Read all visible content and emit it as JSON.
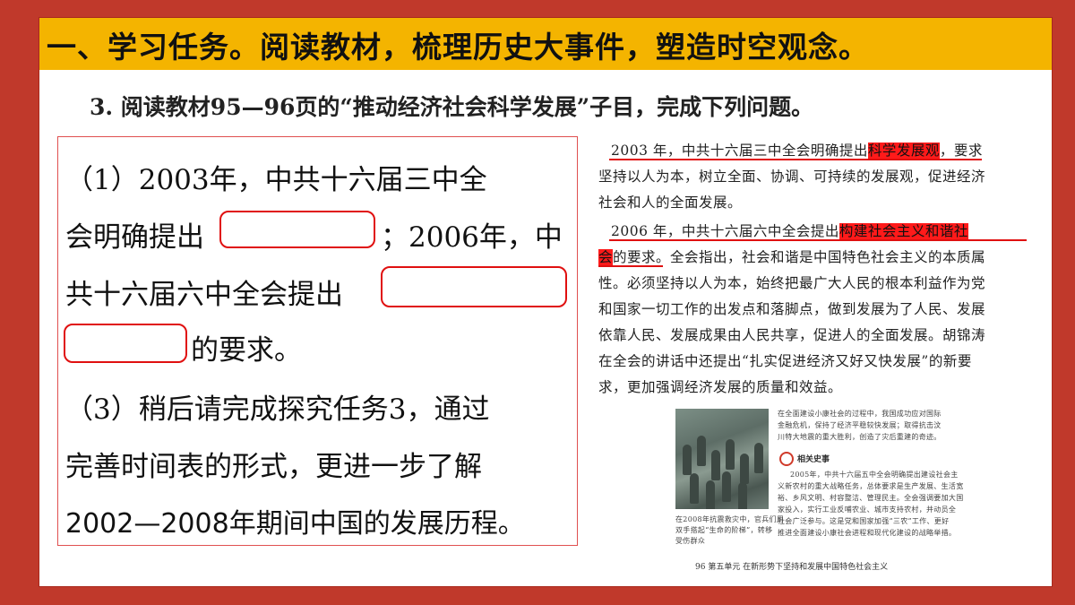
{
  "banner": {
    "title": "一、学习任务。阅读教材，梳理历史大事件，塑造时空观念。"
  },
  "subtitle": "3. 阅读教材95—96页的“推动经济社会科学发展”子目，完成下列问题。",
  "question": {
    "line1": "（1）2003年，中共十六届三中全",
    "line2a": "会明确提出",
    "line2b": "；2006年，中",
    "line3": "共十六届六中全会提出",
    "line4": "的要求。",
    "line5": "（3）稍后请完成探究任务3，通过",
    "line6": "完善时间表的形式，更进一步了解",
    "line7": "2002—2008年期间中国的发展历程。"
  },
  "textbook": {
    "p1_a": "2003 年，中共十六届三中全会明确提出",
    "p1_hl": "科学发展观",
    "p1_b": "，要求",
    "p1_l2": "坚持以人为本，树立全面、协调、可持续的发展观，促进经济",
    "p1_l3": "社会和人的全面发展。",
    "p2_a": "2006 年，中共十六届六中全会提出",
    "p2_hl": "构建社会主义和谐社",
    "p2_hl2": "会",
    "p2_b": "的要求。全会指出，社会和谐是中国特色社会主义的本质属",
    "p2_l3": "性。必须坚持以人为本，始终把最广大人民的根本利益作为党",
    "p2_l4": "和国家一切工作的出发点和落脚点，做到发展为了人民、发展",
    "p2_l5": "依靠人民、发展成果由人民共享，促进人的全面发展。胡锦涛",
    "p2_l6": "在全会的讲话中还提出“扎实促进经济又好又快发展”的新要",
    "p2_l7": "求，更加强调经济发展的质量和效益。",
    "caption_r1": "在全面建设小康社会的过程中，我国成功应对国际",
    "caption_r2": "金融危机，保持了经济平稳较快发展；取得抗击汶",
    "caption_r3": "川特大地震的重大胜利，创造了灾后重建的奇迹。",
    "related_title": "相关史事",
    "related_1": "2005年，中共十六届五中全会明确提出建设社会主",
    "related_2": "义新农村的重大战略任务，总体要求是生产发展、生活宽",
    "related_3": "裕、乡风文明、村容整洁、管理民主。全会强调要加大国",
    "related_4": "家投入，实行工业反哺农业、城市支持农村，并动员全",
    "related_5": "社会广泛参与。这是党和国家加强“三农”工作、更好",
    "related_6": "推进全面建设小康社会进程和现代化建设的战略举措。",
    "photo_cap1": "在2008年抗震救灾中，官兵们用",
    "photo_cap2": "双手搭起“生命的阶梯”，转移",
    "photo_cap3": "受伤群众",
    "footer": "96  第五单元    在新形势下坚持和发展中国特色社会主义"
  }
}
